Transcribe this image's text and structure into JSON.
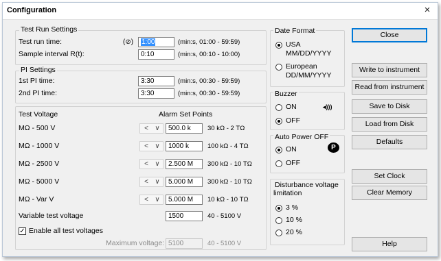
{
  "window": {
    "title": "Configuration",
    "close_glyph": "×"
  },
  "test_run": {
    "heading": "Test Run Settings",
    "run_time_label": "Test run time:",
    "timer_icon": "(⊘)",
    "run_time_value": "1:00",
    "run_time_hint": "(min:s, 01:00 - 59:59)",
    "interval_label": "Sample interval R(t):",
    "interval_value": "0:10",
    "interval_hint": "(min:s, 00:10 - 10:00)"
  },
  "pi": {
    "heading": "PI Settings",
    "first_label": "1st PI time:",
    "first_value": "3:30",
    "first_hint": "(min:s, 00:30 - 59:59)",
    "second_label": "2nd PI time:",
    "second_value": "3:30",
    "second_hint": "(min:s, 00:30 - 59:59)"
  },
  "voltage": {
    "heading": "Test Voltage",
    "alarm_heading": "Alarm Set Points",
    "rows": [
      {
        "label": "MΩ - 500 V",
        "value": "500.0 k",
        "range": "30 kΩ - 2 TΩ"
      },
      {
        "label": "MΩ - 1000 V",
        "value": "1000 k",
        "range": "100 kΩ - 4 TΩ"
      },
      {
        "label": "MΩ - 2500 V",
        "value": "2.500 M",
        "range": "300 kΩ - 10 TΩ"
      },
      {
        "label": "MΩ - 5000 V",
        "value": "5.000 M",
        "range": "300 kΩ - 10 TΩ"
      },
      {
        "label": "MΩ - Var V",
        "value": "5.000 M",
        "range": "10 kΩ - 10 TΩ"
      }
    ],
    "spin_prev": "<",
    "spin_next": "∨",
    "variable_label": "Variable test voltage",
    "variable_value": "1500",
    "variable_range": "40 - 5100 V",
    "enable_label": "Enable all test voltages",
    "enable_checked": true,
    "check_glyph": "✓",
    "max_label": "Maximum voltage:",
    "max_value": "5100",
    "max_range": "40 - 5100 V"
  },
  "date_format": {
    "heading": "Date Format",
    "usa_line1": "USA",
    "usa_line2": "MM/DD/YYYY",
    "eu_line1": "European",
    "eu_line2": "DD/MM/YYYY",
    "selected": "USA"
  },
  "buzzer": {
    "heading": "Buzzer",
    "on": "ON",
    "off": "OFF",
    "icon_glyph": "◂)))",
    "selected": "OFF"
  },
  "auto_power": {
    "heading": "Auto Power OFF",
    "on": "ON",
    "off": "OFF",
    "badge": "P",
    "selected": "ON"
  },
  "disturbance": {
    "heading_line1": "Disturbance voltage",
    "heading_line2": "limitation",
    "options": [
      "3 %",
      "10 %",
      "20 %"
    ],
    "selected": "3 %"
  },
  "buttons": {
    "close": "Close",
    "write": "Write to instrument",
    "read": "Read from instrument",
    "save": "Save to Disk",
    "load": "Load from Disk",
    "defaults": "Defaults",
    "set_clock": "Set Clock",
    "clear_memory": "Clear Memory",
    "help": "Help"
  }
}
